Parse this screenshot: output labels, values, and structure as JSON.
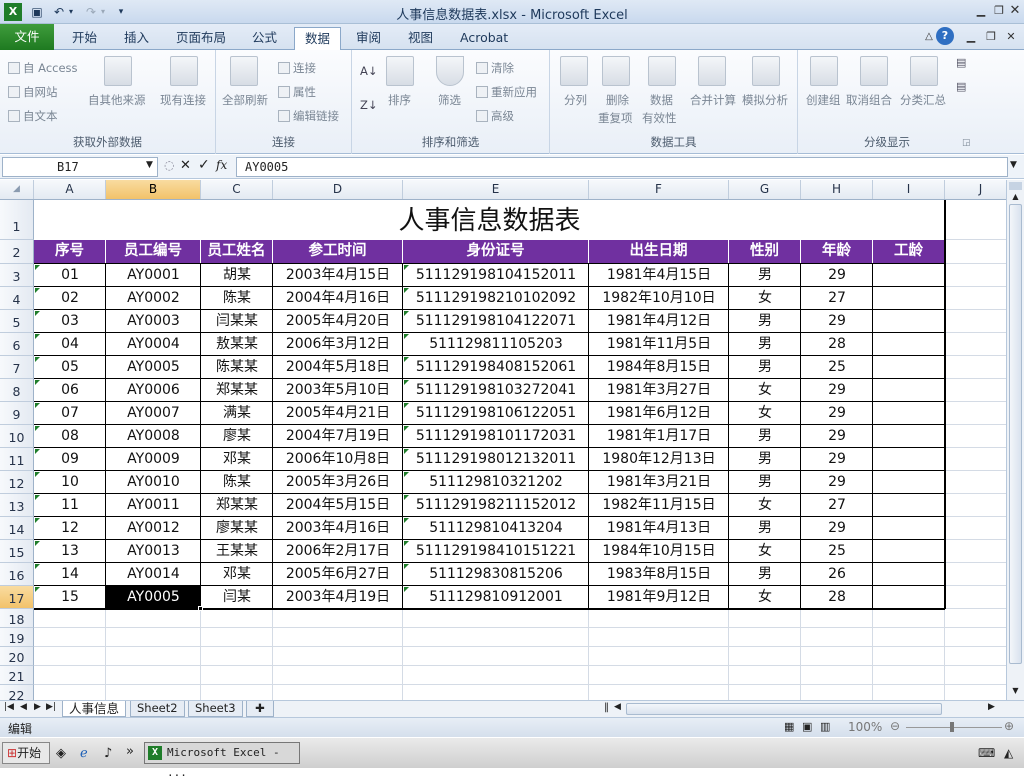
{
  "window": {
    "title": "人事信息数据表.xlsx - Microsoft Excel"
  },
  "ribbon": {
    "tabs": [
      "文件",
      "开始",
      "插入",
      "页面布局",
      "公式",
      "数据",
      "审阅",
      "视图",
      "Acrobat"
    ],
    "active_tab": "数据",
    "groups": {
      "external": {
        "label": "获取外部数据",
        "items": [
          "自 Access",
          "自网站",
          "自文本",
          "自其他来源",
          "现有连接"
        ]
      },
      "connections": {
        "label": "连接",
        "items": [
          "全部刷新",
          "连接",
          "属性",
          "编辑链接"
        ]
      },
      "sort": {
        "label": "排序和筛选",
        "items": [
          "排序",
          "筛选",
          "清除",
          "重新应用",
          "高级"
        ]
      },
      "tools": {
        "label": "数据工具",
        "items": [
          "分列",
          "删除",
          "重复项",
          "数据",
          "有效性",
          "合并计算",
          "模拟分析"
        ]
      },
      "outline": {
        "label": "分级显示",
        "items": [
          "创建组",
          "取消组合",
          "分类汇总"
        ]
      }
    }
  },
  "formula_bar": {
    "name_box": "B17",
    "value": "AY0005"
  },
  "columns": [
    "A",
    "B",
    "C",
    "D",
    "E",
    "F",
    "G",
    "H",
    "I",
    "J"
  ],
  "selected_column": "B",
  "rows": [
    "1",
    "2",
    "3",
    "4",
    "5",
    "6",
    "7",
    "8",
    "9",
    "10",
    "11",
    "12",
    "13",
    "14",
    "15",
    "16",
    "17",
    "18",
    "19",
    "20",
    "21",
    "22"
  ],
  "selected_row": "17",
  "sheet": {
    "title": "人事信息数据表",
    "headers": [
      "序号",
      "员工编号",
      "员工姓名",
      "参工时间",
      "身份证号",
      "出生日期",
      "性别",
      "年龄",
      "工龄"
    ],
    "records": [
      [
        "01",
        "AY0001",
        "胡某",
        "2003年4月15日",
        "511129198104152011",
        "1981年4月15日",
        "男",
        "29",
        ""
      ],
      [
        "02",
        "AY0002",
        "陈某",
        "2004年4月16日",
        "511129198210102092",
        "1982年10月10日",
        "女",
        "27",
        ""
      ],
      [
        "03",
        "AY0003",
        "闫某某",
        "2005年4月20日",
        "511129198104122071",
        "1981年4月12日",
        "男",
        "29",
        ""
      ],
      [
        "04",
        "AY0004",
        "敖某某",
        "2006年3月12日",
        "51112981110520​3",
        "1981年11月5日",
        "男",
        "28",
        ""
      ],
      [
        "05",
        "AY0005",
        "陈某某",
        "2004年5月18日",
        "511129198408152061",
        "1984年8月15日",
        "男",
        "25",
        ""
      ],
      [
        "06",
        "AY0006",
        "郑某某",
        "2003年5月10日",
        "511129198103272041",
        "1981年3月27日",
        "女",
        "29",
        ""
      ],
      [
        "07",
        "AY0007",
        "满某",
        "2005年4月21日",
        "511129198106122051",
        "1981年6月12日",
        "女",
        "29",
        ""
      ],
      [
        "08",
        "AY0008",
        "廖某",
        "2004年7月19日",
        "511129198101172031",
        "1981年1月17日",
        "男",
        "29",
        ""
      ],
      [
        "09",
        "AY0009",
        "邓某",
        "2006年10月8日",
        "511129198012132011",
        "1980年12月13日",
        "男",
        "29",
        ""
      ],
      [
        "10",
        "AY0010",
        "陈某",
        "2005年3月26日",
        "511129810321202",
        "1981年3月21日",
        "男",
        "29",
        ""
      ],
      [
        "11",
        "AY0011",
        "郑某某",
        "2004年5月15日",
        "511129198211152012",
        "1982年11月15日",
        "女",
        "27",
        ""
      ],
      [
        "12",
        "AY0012",
        "廖某某",
        "2003年4月16日",
        "511129810413204",
        "1981年4月13日",
        "男",
        "29",
        ""
      ],
      [
        "13",
        "AY0013",
        "王某某",
        "2006年2月17日",
        "511129198410151221",
        "1984年10月15日",
        "女",
        "25",
        ""
      ],
      [
        "14",
        "AY0014",
        "邓某",
        "2005年6月27日",
        "511129830815206",
        "1983年8月15日",
        "男",
        "26",
        ""
      ],
      [
        "15",
        "AY0005",
        "闫某",
        "2003年4月19日",
        "511129810912001",
        "1981年9月12日",
        "女",
        "28",
        ""
      ]
    ]
  },
  "sheet_tabs": [
    "人事信息",
    "Sheet2",
    "Sheet3"
  ],
  "active_sheet": "人事信息",
  "status": {
    "mode": "编辑",
    "zoom": "100%"
  },
  "taskbar": {
    "start": "开始",
    "app": "Microsoft Excel - ..."
  },
  "colors": {
    "header_fill": "#7030a0",
    "file_tab": "#2a8a2a",
    "selection": "#000000"
  }
}
